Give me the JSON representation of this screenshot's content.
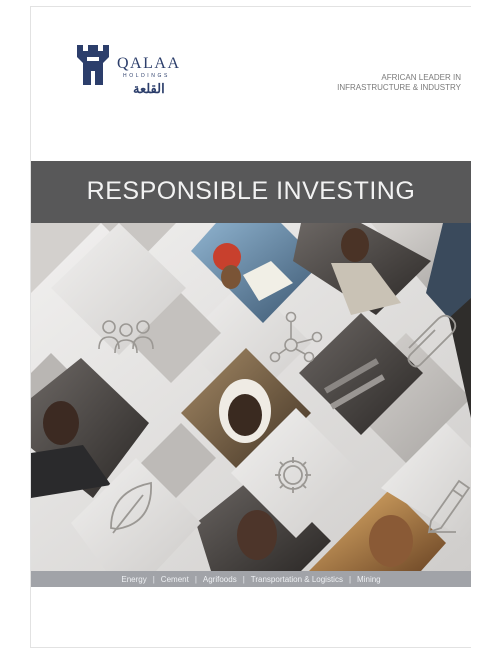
{
  "cover": {
    "brand": {
      "name": "QALAA",
      "subline": "HOLDINGS",
      "arabic": "القلعة"
    },
    "tagline": [
      "AFRICAN LEADER IN",
      "INFRASTRUCTURE & INDUSTRY"
    ],
    "title": "RESPONSIBLE INVESTING",
    "sectors": [
      "Energy",
      "Cement",
      "Agrifoods",
      "Transportation & Logistics",
      "Mining"
    ],
    "separator": "|",
    "icons": [
      "people-icon",
      "network-icon",
      "paperclip-icon",
      "leaf-icon",
      "gear-icon",
      "pencil-icon"
    ],
    "colors": {
      "title_band": "#585859",
      "footer_band": "#a1a3a8",
      "logo": "#2c3e6b",
      "mosaic_light": "#e6e5e4"
    }
  }
}
